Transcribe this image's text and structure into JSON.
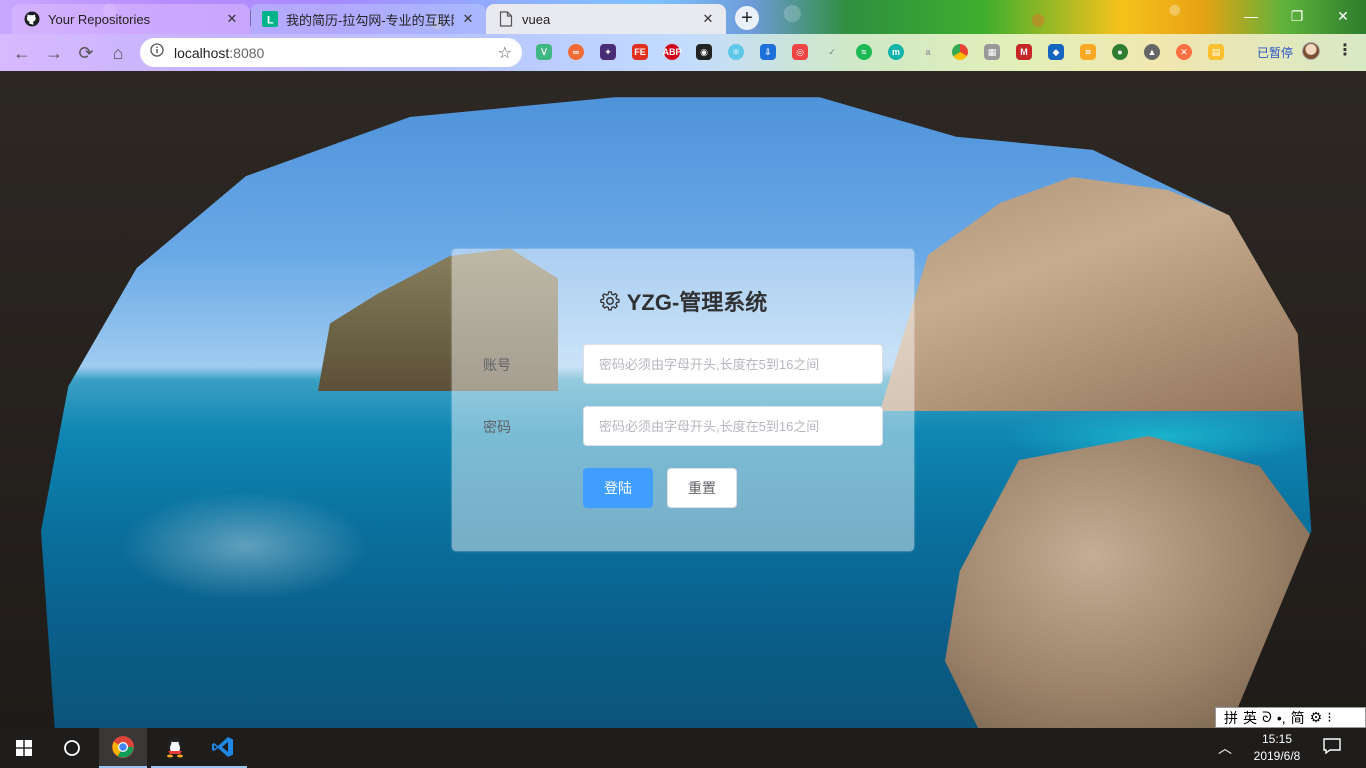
{
  "browser": {
    "tabs": [
      {
        "title": "Your Repositories",
        "icon": "github-icon"
      },
      {
        "title": "我的简历-拉勾网-专业的互联网招聘平台",
        "icon": "lagou-icon"
      },
      {
        "title": "vuea",
        "icon": "page-icon",
        "active": true
      }
    ],
    "new_tab_label": "+",
    "url_host": "localhost",
    "url_port": ":8080",
    "profile_status": "已暂停",
    "accent": "#409eff"
  },
  "login": {
    "title": "YZG-管理系统",
    "title_icon": "gear-icon",
    "account_label": "账号",
    "account_placeholder": "密码必须由字母开头,长度在5到16之间",
    "password_label": "密码",
    "password_placeholder": "密码必须由字母开头,长度在5到16之间",
    "login_button": "登陆",
    "reset_button": "重置"
  },
  "ime": {
    "items": [
      "拼",
      "英",
      "ᘐ",
      "•,",
      "简",
      "⚙",
      "⁝"
    ]
  },
  "taskbar": {
    "time": "15:15",
    "date": "2019/6/8"
  }
}
